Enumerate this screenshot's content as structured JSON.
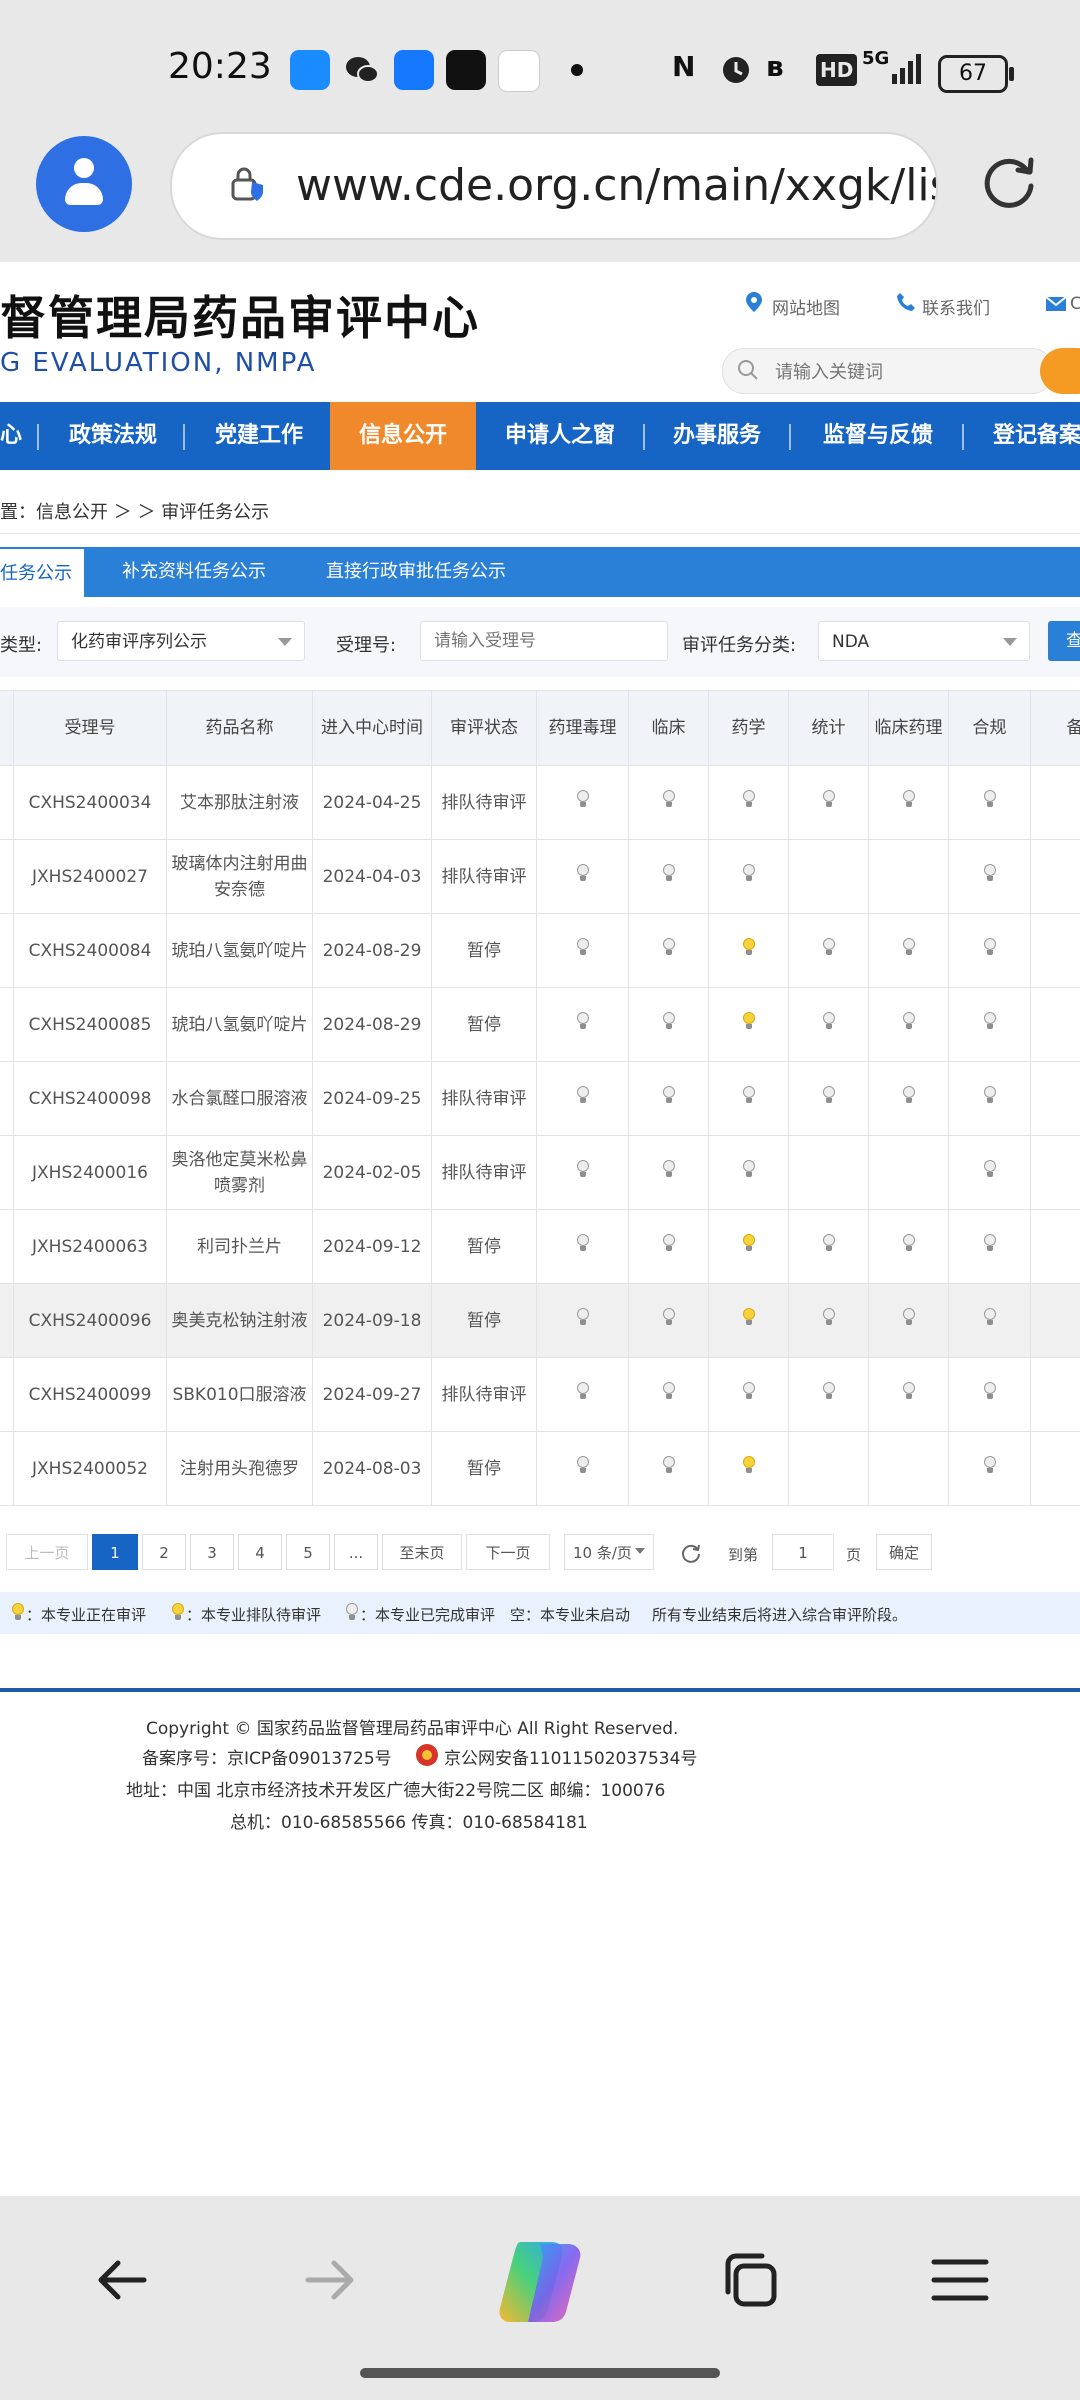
{
  "status_bar": {
    "time": "20:23",
    "battery": "67",
    "network": "5G",
    "hd": "HD"
  },
  "browser": {
    "url": "www.cde.org.cn/main/xxgk/listpage"
  },
  "header": {
    "title": "督管理局药品审评中心",
    "subtitle": "G EVALUATION, NMPA",
    "links": {
      "sitemap": "网站地图",
      "contact": "联系我们",
      "mail": "C"
    },
    "search_placeholder": "请输入关键词"
  },
  "nav": {
    "items": [
      "心",
      "政策法规",
      "党建工作",
      "信息公开",
      "申请人之窗",
      "办事服务",
      "监督与反馈",
      "登记备案"
    ],
    "active": "信息公开"
  },
  "breadcrumb": "置：信息公开 ＞ ＞ 审评任务公示",
  "tabs": [
    "任务公示",
    "补充资料任务公示",
    "直接行政审批任务公示"
  ],
  "filter": {
    "type_label": "类型:",
    "type_value": "化药审评序列公示",
    "accept_label": "受理号:",
    "accept_placeholder": "请输入受理号",
    "category_label": "审评任务分类:",
    "category_value": "NDA",
    "query_label": "查"
  },
  "table": {
    "headers": [
      "受理号",
      "药品名称",
      "进入中心时间",
      "审评状态",
      "药理毒理",
      "临床",
      "药学",
      "统计",
      "临床药理",
      "合规",
      "备"
    ],
    "rows": [
      {
        "id": "CXHS2400034",
        "name": "艾本那肽注射液",
        "date": "2024-04-25",
        "status": "排队待审评",
        "lights": [
          "g",
          "g",
          "g",
          "g",
          "g",
          "g"
        ]
      },
      {
        "id": "JXHS2400027",
        "name": "玻璃体内注射用曲安奈德",
        "date": "2024-04-03",
        "status": "排队待审评",
        "lights": [
          "g",
          "g",
          "g",
          "",
          "",
          "g"
        ]
      },
      {
        "id": "CXHS2400084",
        "name": "琥珀八氢氨吖啶片",
        "date": "2024-08-29",
        "status": "暂停",
        "lights": [
          "g",
          "g",
          "y",
          "g",
          "g",
          "g"
        ]
      },
      {
        "id": "CXHS2400085",
        "name": "琥珀八氢氨吖啶片",
        "date": "2024-08-29",
        "status": "暂停",
        "lights": [
          "g",
          "g",
          "y",
          "g",
          "g",
          "g"
        ]
      },
      {
        "id": "CXHS2400098",
        "name": "水合氯醛口服溶液",
        "date": "2024-09-25",
        "status": "排队待审评",
        "lights": [
          "g",
          "g",
          "g",
          "g",
          "g",
          "g"
        ]
      },
      {
        "id": "JXHS2400016",
        "name": "奥洛他定莫米松鼻喷雾剂",
        "date": "2024-02-05",
        "status": "排队待审评",
        "lights": [
          "g",
          "g",
          "g",
          "",
          "",
          "g"
        ]
      },
      {
        "id": "JXHS2400063",
        "name": "利司扑兰片",
        "date": "2024-09-12",
        "status": "暂停",
        "lights": [
          "g",
          "g",
          "y",
          "g",
          "g",
          "g"
        ]
      },
      {
        "id": "CXHS2400096",
        "name": "奥美克松钠注射液",
        "date": "2024-09-18",
        "status": "暂停",
        "lights": [
          "g",
          "g",
          "y",
          "g",
          "g",
          "g"
        ]
      },
      {
        "id": "CXHS2400099",
        "name": "SBK010口服溶液",
        "date": "2024-09-27",
        "status": "排队待审评",
        "lights": [
          "g",
          "g",
          "g",
          "g",
          "g",
          "g"
        ]
      },
      {
        "id": "JXHS2400052",
        "name": "注射用头孢德罗",
        "date": "2024-08-03",
        "status": "暂停",
        "lights": [
          "g",
          "g",
          "y",
          "",
          "",
          "g"
        ]
      }
    ]
  },
  "pager": {
    "prev": "上一页",
    "pages": [
      "1",
      "2",
      "3",
      "4",
      "5",
      "..."
    ],
    "current": "1",
    "last": "至末页",
    "next": "下一页",
    "page_size": "10 条/页",
    "goto_label": "到第",
    "goto_value": "1",
    "page_unit": "页",
    "confirm": "确定"
  },
  "legend": {
    "in_review": "：本专业正在审评",
    "queued": "：本专业排队待审评",
    "done": "：本专业已完成审评",
    "not_started": "空：本专业未启动",
    "note": "所有专业结束后将进入综合审评阶段。"
  },
  "footer": {
    "copyright": "Copyright © 国家药品监督管理局药品审评中心   All Right Reserved.",
    "icp": "备案序号：京ICP备09013725号",
    "police": "京公网安备11011502037534号",
    "address": "地址：中国 北京市经济技术开发区广德大街22号院二区      邮编：100076",
    "phone": "总机：010-68585566        传真：010-68584181"
  },
  "colors": {
    "nav_blue": "#1664c4",
    "nav_active": "#f0892b",
    "tab_blue": "#2a7fd6",
    "light_yellow": "#f7d23a",
    "light_grey": "#eeeeee"
  }
}
